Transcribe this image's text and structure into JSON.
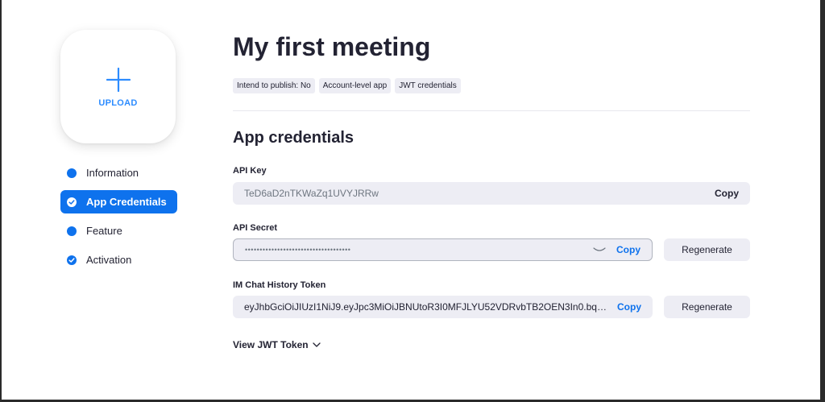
{
  "upload": {
    "label": "UPLOAD",
    "icon": "plus-icon"
  },
  "nav": {
    "items": [
      {
        "label": "Information",
        "state": "default"
      },
      {
        "label": "App Credentials",
        "state": "active"
      },
      {
        "label": "Feature",
        "state": "default"
      },
      {
        "label": "Activation",
        "state": "completed"
      }
    ]
  },
  "header": {
    "title": "My first meeting",
    "tags": [
      "Intend to publish: No",
      "Account-level app",
      "JWT credentials"
    ]
  },
  "credentials": {
    "title": "App credentials",
    "api_key": {
      "label": "API Key",
      "value": "TeD6aD2nTKWaZq1UVYJRRw",
      "copy_label": "Copy"
    },
    "api_secret": {
      "label": "API Secret",
      "value": "••••••••••••••••••••••••••••••••••••",
      "copy_label": "Copy",
      "regenerate_label": "Regenerate"
    },
    "im_token": {
      "label": "IM Chat History Token",
      "value": "eyJhbGciOiJIUzI1NiJ9.eyJpc3MiOiJBNUtoR3I0MFJLYU52VDRvbTB2OEN3In0.bqG...",
      "copy_label": "Copy",
      "regenerate_label": "Regenerate"
    },
    "view_jwt_label": "View JWT Token"
  },
  "colors": {
    "accent": "#0e72ed",
    "upload_blue": "#2d8cff",
    "field_bg": "#ededf4"
  }
}
